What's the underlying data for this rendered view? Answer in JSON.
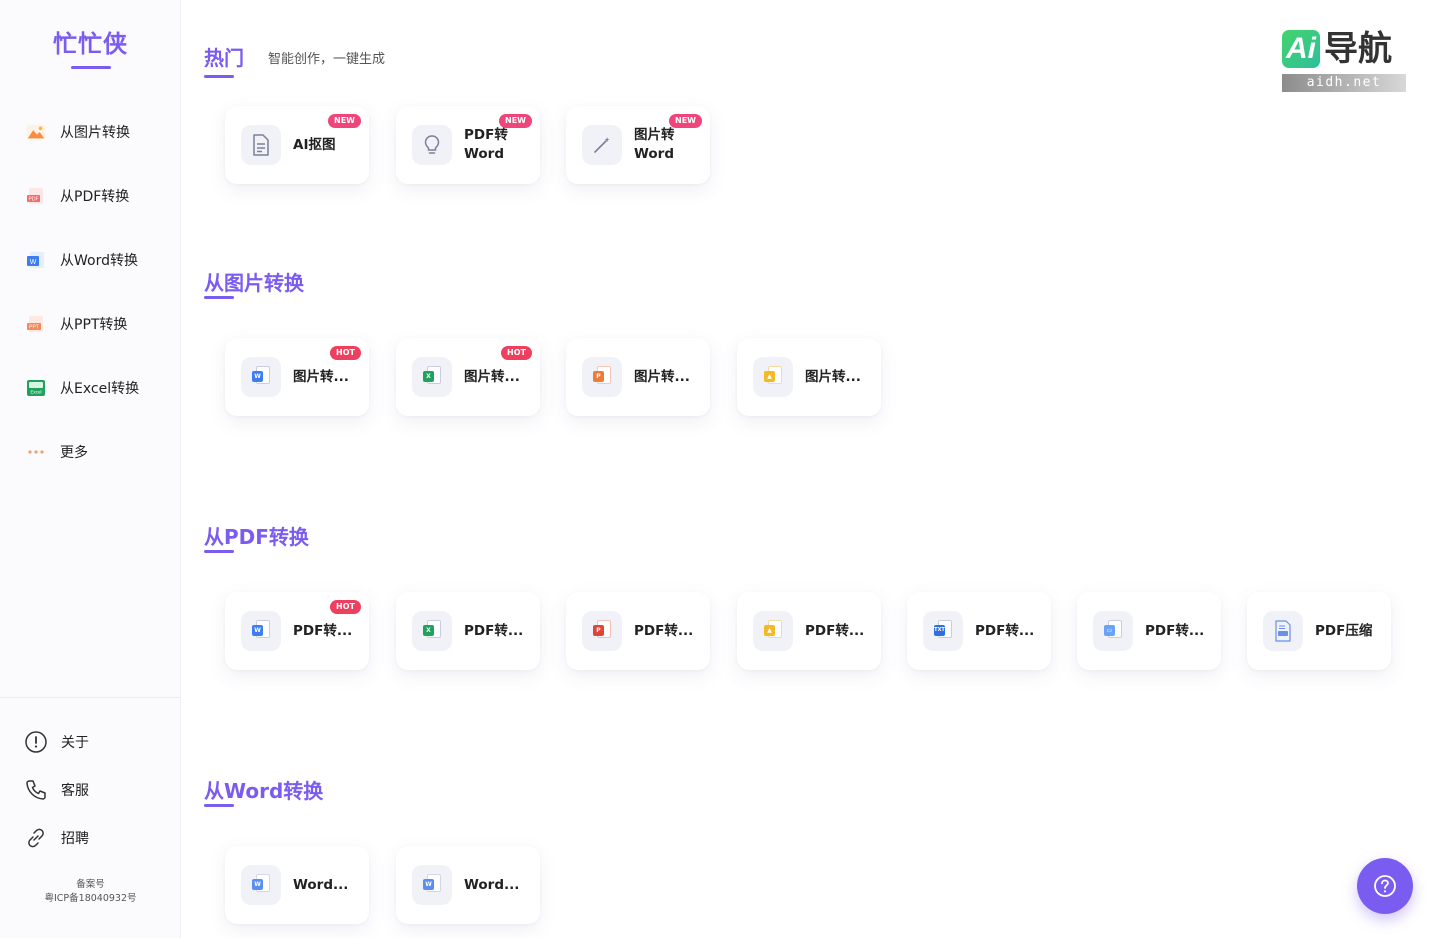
{
  "sidebar": {
    "brand": "忙忙侠",
    "items": [
      {
        "label": "从图片转换",
        "icon": "image-icon"
      },
      {
        "label": "从PDF转换",
        "icon": "pdf-file-icon"
      },
      {
        "label": "从Word转换",
        "icon": "word-file-icon"
      },
      {
        "label": "从PPT转换",
        "icon": "ppt-file-icon"
      },
      {
        "label": "从Excel转换",
        "icon": "excel-file-icon"
      },
      {
        "label": "更多",
        "icon": "more-dots-icon"
      }
    ],
    "bottom": [
      {
        "label": "关于",
        "icon": "info-circle-icon"
      },
      {
        "label": "客服",
        "icon": "phone-icon"
      },
      {
        "label": "招聘",
        "icon": "link-icon"
      }
    ],
    "icp_line1": "备案号",
    "icp_line2": "粤ICP备18040932号"
  },
  "hot": {
    "title": "热门",
    "subtitle": "智能创作，一键生成",
    "cards": [
      {
        "label": "AI抠图",
        "badge": "NEW",
        "icon": "document-icon"
      },
      {
        "label_line1": "PDF转",
        "label_line2": "Word",
        "badge": "NEW",
        "icon": "lightbulb-icon"
      },
      {
        "label_line1": "图片转",
        "label_line2": "Word",
        "badge": "NEW",
        "icon": "magic-wand-icon"
      }
    ]
  },
  "from_image": {
    "title": "从图片转换",
    "cards": [
      {
        "label": "图片转...",
        "badge": "HOT",
        "icon": "word-doc-icon"
      },
      {
        "label": "图片转...",
        "badge": "HOT",
        "icon": "excel-doc-icon"
      },
      {
        "label": "图片转...",
        "icon": "ppt-doc-icon"
      },
      {
        "label": "图片转...",
        "icon": "image-doc-icon"
      }
    ]
  },
  "from_pdf": {
    "title": "从PDF转换",
    "cards": [
      {
        "label": "PDF转...",
        "badge": "HOT",
        "icon": "word-doc-icon"
      },
      {
        "label": "PDF转...",
        "icon": "excel-doc-icon"
      },
      {
        "label": "PDF转...",
        "icon": "ppt-doc-icon"
      },
      {
        "label": "PDF转...",
        "icon": "image-doc-icon"
      },
      {
        "label": "PDF转...",
        "icon": "txt-doc-icon"
      },
      {
        "label": "PDF转...",
        "icon": "html-doc-icon"
      },
      {
        "label": "PDF压缩",
        "icon": "pdf-compress-icon"
      }
    ]
  },
  "from_word": {
    "title": "从Word转换",
    "cards": [
      {
        "label": "Word...",
        "icon": "word-to-pdf-icon"
      },
      {
        "label": "Word...",
        "icon": "word-to-pdf-icon"
      }
    ]
  },
  "watermark": {
    "badge": "Ai",
    "text": "导航",
    "domain": "aidh.net"
  },
  "colors": {
    "accent": "#7a5cf0",
    "badge_new": "#f0457b",
    "badge_hot": "#ee3f5f"
  }
}
